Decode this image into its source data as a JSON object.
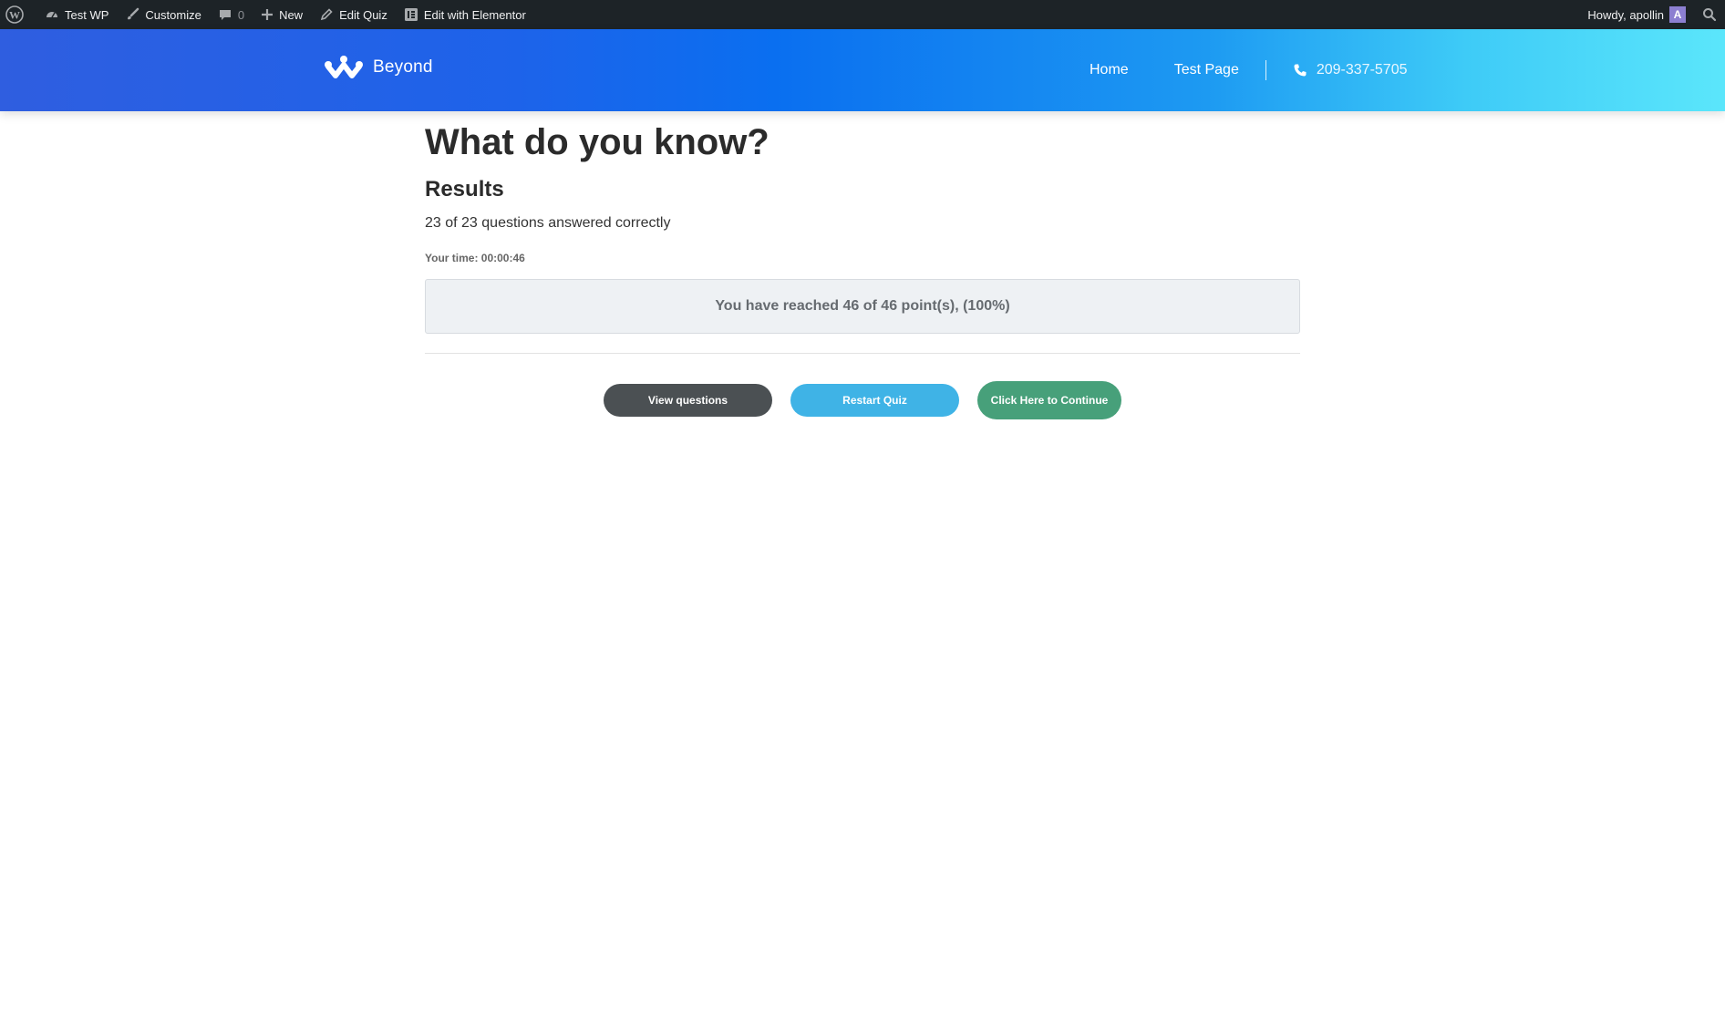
{
  "admin_bar": {
    "site_name": "Test WP",
    "customize": "Customize",
    "comments_count": "0",
    "new": "New",
    "edit_quiz": "Edit Quiz",
    "edit_elementor": "Edit with Elementor",
    "greeting": "Howdy, apollin",
    "avatar_letter": "A"
  },
  "header": {
    "brand": "Beyond",
    "nav": [
      "Home",
      "Test Page"
    ],
    "phone": "209-337-5705"
  },
  "quiz": {
    "title": "What do you know?",
    "results_heading": "Results",
    "answered": "23 of 23 questions answered correctly",
    "time": "Your time: 00:00:46",
    "points": "You have reached 46 of 46 point(s), (100%)",
    "buttons": {
      "view": "View questions",
      "restart": "Restart Quiz",
      "continue": "Click Here to Continue"
    }
  },
  "colors": {
    "admin_bar": "#1d2327",
    "header_start": "#2f5ee0",
    "header_end": "#5be6fb",
    "btn_view": "#4b5053",
    "btn_restart": "#3fb3e6",
    "btn_continue": "#47a07a"
  }
}
